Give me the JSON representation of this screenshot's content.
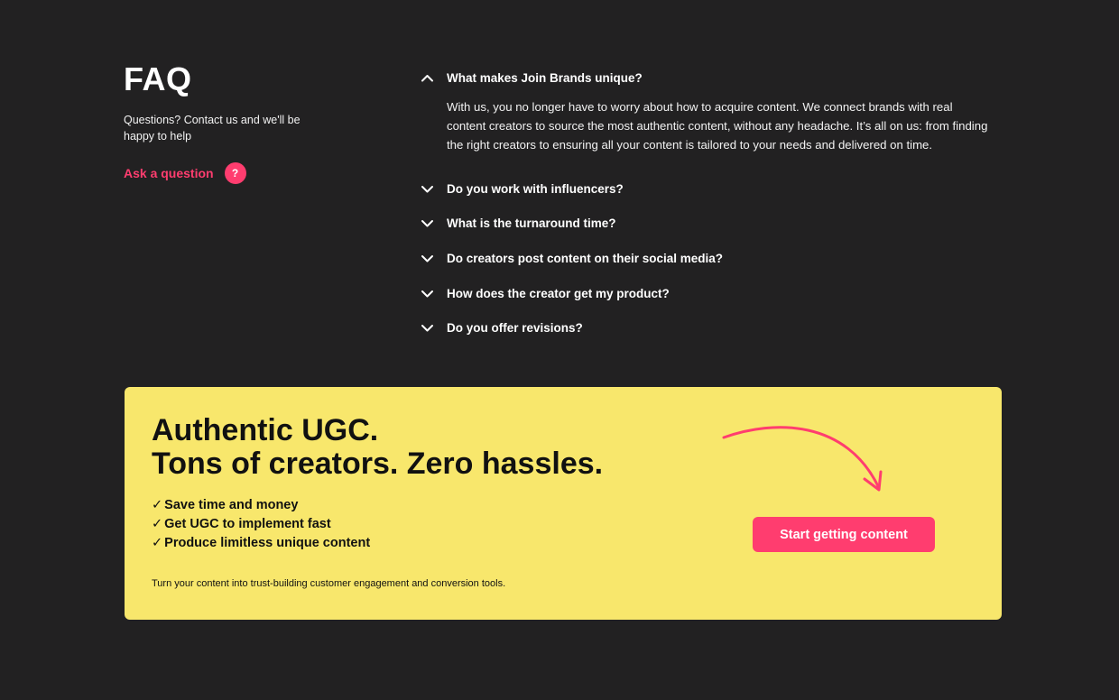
{
  "faq": {
    "title": "FAQ",
    "subtitle": "Questions? Contact us and we'll be happy to help",
    "ask_label": "Ask a question",
    "ask_icon_text": "?",
    "items": [
      {
        "question": "What makes Join Brands unique?",
        "answer": "With us, you no longer have to worry about how to acquire content. We connect brands with real content creators to source the most authentic content, without any headache. It’s all on us: from finding the right creators to ensuring all your content is tailored to your needs and delivered on time.",
        "expanded": true
      },
      {
        "question": "Do you work with influencers?",
        "expanded": false
      },
      {
        "question": "What is the turnaround time?",
        "expanded": false
      },
      {
        "question": "Do creators post content on their social media?",
        "expanded": false
      },
      {
        "question": "How does the creator get my product?",
        "expanded": false
      },
      {
        "question": "Do you offer revisions?",
        "expanded": false
      }
    ]
  },
  "cta": {
    "headline_line1": "Authentic UGC.",
    "headline_line2": "Tons of creators. Zero hassles.",
    "check_mark": "✓",
    "benefits": [
      "Save time and money",
      "Get UGC to implement fast",
      "Produce limitless unique content"
    ],
    "footer": "Turn your content into trust-building customer engagement and conversion tools.",
    "button_label": "Start getting content"
  },
  "colors": {
    "background": "#222122",
    "accent": "#ff3d6f",
    "cta_background": "#f8e76c"
  },
  "icons": {
    "expanded": "chevron-up-icon",
    "collapsed": "chevron-down-icon",
    "arrow": "curved-arrow-icon"
  }
}
